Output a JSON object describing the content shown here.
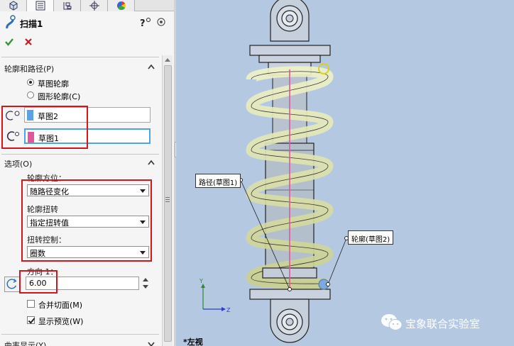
{
  "feature": {
    "title": "扫描1",
    "icon": "sweep-icon",
    "help_glyph": "?"
  },
  "profile_path": {
    "header": "轮廓和路径(P)",
    "radio_sketch": "草图轮廓",
    "radio_circle": "圆形轮廓(C)",
    "profile_selection": "草图2",
    "path_selection": "草图1",
    "profile_color": "#5aa2e6",
    "path_color": "#e0579b"
  },
  "options": {
    "header": "选项(O)",
    "orientation_label": "轮廓方位：",
    "orientation_value": "随路径变化",
    "twist_label": "轮廓扭转",
    "twist_value": "指定扭转值",
    "twist_control_label": "扭转控制：",
    "twist_control_value": "圈数",
    "direction_label": "方向 1：",
    "direction_value": "6.00",
    "merge_tangent": "合并切面(M)",
    "show_preview": "显示预览(W)",
    "merge_tangent_checked": false,
    "show_preview_checked": true
  },
  "next_section": {
    "header": "曲率显示(Y)"
  },
  "viewport": {
    "callout_path": "路径(草图1)",
    "callout_profile": "轮廓(草图2)",
    "view_label": "*左视",
    "axis_y": "Y",
    "axis_z": "Z",
    "watermark": "宝象联合实验室",
    "background_color": "#b4c8e2"
  },
  "colors": {
    "highlight_red": "#d2161b",
    "accent_blue": "#4ea3e0",
    "confirm_green": "#2e9a2e",
    "cancel_red": "#c8181e"
  }
}
